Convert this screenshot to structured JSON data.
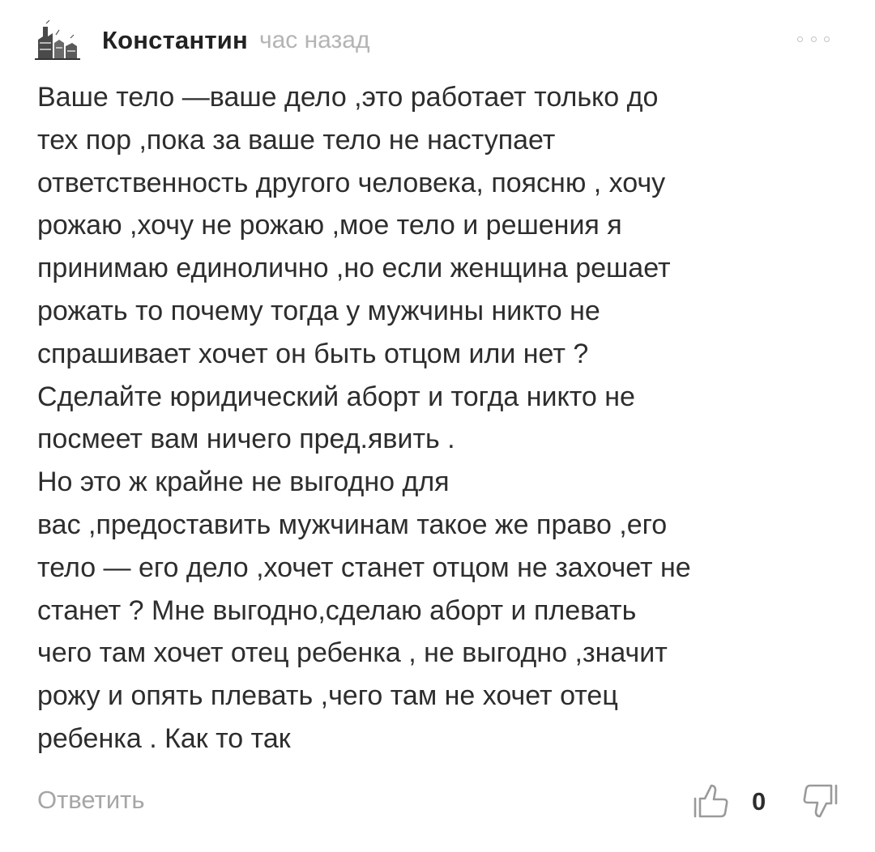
{
  "comment": {
    "author": "Константин",
    "time": "час назад",
    "lines": [
      "Ваше тело —ваше дело ,это работает только до",
      "тех пор ,пока за ваше тело не наступает",
      "ответственность другого человека, поясню , хочу",
      "рожаю ,хочу не рожаю ,мое тело и решения я",
      "принимаю единолично ,но если женщина решает",
      "рожать то почему тогда у мужчины никто не",
      "спрашивает хочет он быть отцом или нет ?",
      "Сделайте юридический аборт и тогда никто не",
      "посмеет вам ничего пред.явить .",
      "Но это ж крайне не выгодно для",
      "вас ,предоставить мужчинам такое же право ,его",
      "тело — его дело ,хочет станет отцом не захочет не",
      "станет ? Мне выгодно,сделаю аборт и плевать",
      "чего там хочет отец ребенка , не выгодно ,значит",
      "рожу и опять плевать ,чего там не хочет отец",
      "ребенка . Как то так"
    ],
    "reply_label": "Ответить",
    "rating": "0"
  },
  "icons": {
    "avatar": "avatar-image",
    "more": "more-dots-icon",
    "upvote": "thumbs-up-icon",
    "downvote": "thumbs-down-icon"
  }
}
